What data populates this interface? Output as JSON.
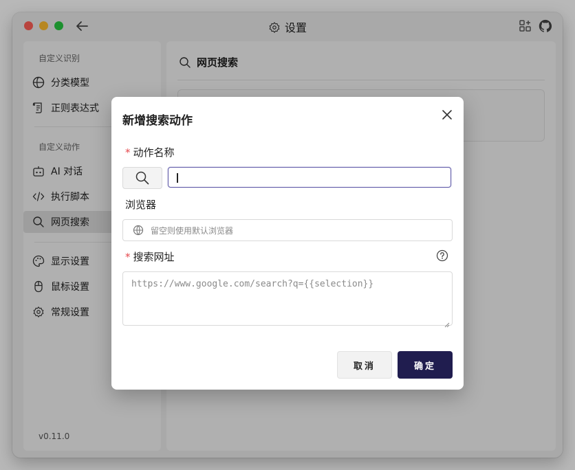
{
  "window": {
    "title": "设置"
  },
  "sidebar": {
    "section1_title": "自定义识别",
    "section1_items": [
      {
        "label": "分类模型",
        "icon": "globe-icon"
      },
      {
        "label": "正则表达式",
        "icon": "scroll-icon"
      }
    ],
    "section2_title": "自定义动作",
    "section2_items": [
      {
        "label": "AI 对话",
        "icon": "robot-icon"
      },
      {
        "label": "执行脚本",
        "icon": "code-icon"
      },
      {
        "label": "网页搜索",
        "icon": "search-icon",
        "active": true
      }
    ],
    "section3_items": [
      {
        "label": "显示设置",
        "icon": "palette-icon"
      },
      {
        "label": "鼠标设置",
        "icon": "mouse-icon"
      },
      {
        "label": "常规设置",
        "icon": "gear-icon"
      }
    ],
    "version": "v0.11.0"
  },
  "content": {
    "title": "网页搜索"
  },
  "dialog": {
    "title": "新增搜索动作",
    "name_label": "动作名称",
    "required_mark": "*",
    "browser_label": "浏览器",
    "browser_placeholder": "留空则使用默认浏览器",
    "url_label": "搜索网址",
    "url_placeholder": "https://www.google.com/search?q={{selection}}",
    "cancel_label": "取消",
    "ok_label": "确定"
  },
  "colors": {
    "primary": "#201d4f",
    "required": "#e5484d",
    "focus": "#5f5aa8"
  }
}
